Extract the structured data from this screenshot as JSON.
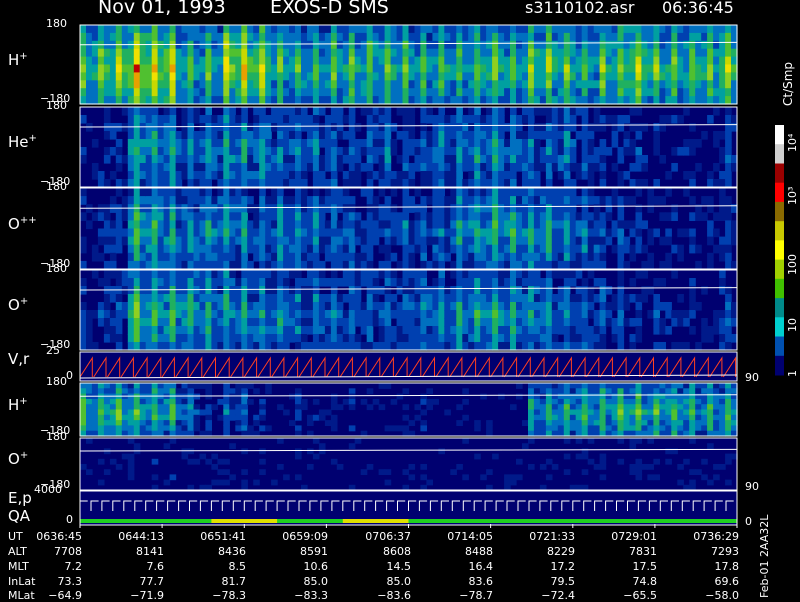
{
  "header": {
    "date": "Nov 01, 1993",
    "instrument": "EXOS-D SMS",
    "file": "s3110102.asr",
    "time": "06:36:45"
  },
  "chart_data": [
    {
      "type": "heatmap",
      "species": "H",
      "charge": "+",
      "y_ticks": [
        "180",
        "−180"
      ],
      "intensity": [
        0.6,
        0.7,
        0.9,
        0.85,
        0.5,
        0.55,
        0.8,
        0.75,
        0.55,
        0.5,
        0.55,
        0.6,
        0.55,
        0.6,
        0.5,
        0.55,
        0.5,
        0.6,
        0.55,
        0.65,
        0.6,
        0.5,
        0.6,
        0.7,
        0.6,
        0.55,
        0.6,
        0.7
      ]
    },
    {
      "type": "heatmap",
      "species": "He",
      "charge": "+",
      "y_ticks": [
        "180",
        "−180"
      ],
      "intensity": [
        0.1,
        0.15,
        0.45,
        0.4,
        0.3,
        0.35,
        0.4,
        0.35,
        0.3,
        0.3,
        0.25,
        0.2,
        0.25,
        0.2,
        0.25,
        0.3,
        0.35,
        0.4,
        0.3,
        0.25,
        0.3,
        0.2,
        0.15,
        0.15,
        0.1,
        0.1,
        0.1,
        0.2
      ]
    },
    {
      "type": "heatmap",
      "species": "O",
      "charge": "++",
      "y_ticks": [
        "180",
        "−180"
      ],
      "intensity": [
        0.1,
        0.2,
        0.5,
        0.45,
        0.35,
        0.4,
        0.35,
        0.3,
        0.35,
        0.3,
        0.25,
        0.25,
        0.2,
        0.25,
        0.25,
        0.3,
        0.4,
        0.45,
        0.45,
        0.4,
        0.35,
        0.3,
        0.2,
        0.15,
        0.1,
        0.1,
        0.1,
        0.2
      ]
    },
    {
      "type": "heatmap",
      "species": "O",
      "charge": "+",
      "y_ticks": [
        "180",
        "−180"
      ],
      "intensity": [
        0.15,
        0.2,
        0.55,
        0.5,
        0.45,
        0.4,
        0.4,
        0.35,
        0.35,
        0.3,
        0.3,
        0.25,
        0.25,
        0.25,
        0.3,
        0.35,
        0.4,
        0.45,
        0.4,
        0.35,
        0.3,
        0.25,
        0.2,
        0.15,
        0.15,
        0.1,
        0.1,
        0.2
      ]
    },
    {
      "type": "line",
      "label": "V,r",
      "y_ticks": [
        "25",
        "0"
      ],
      "right_tick": "90"
    },
    {
      "type": "heatmap",
      "species": "H",
      "charge": "+",
      "y_ticks": [
        "180",
        "−180"
      ],
      "intensity": [
        0.5,
        0.55,
        0.5,
        0.5,
        0.3,
        0.15,
        0.25,
        0.1,
        0.05,
        0.1,
        0.05,
        0.1,
        0.05,
        0.05,
        0.1,
        0.05,
        0.05,
        0.05,
        0.05,
        0.4,
        0.45,
        0.5,
        0.5,
        0.55,
        0.5,
        0.5,
        0.45,
        0.5
      ]
    },
    {
      "type": "heatmap",
      "species": "O",
      "charge": "+",
      "y_ticks": [
        "180",
        "−180"
      ],
      "right_tick": "90",
      "intensity": [
        0.05,
        0.05,
        0.05,
        0.1,
        0.05,
        0.05,
        0.05,
        0.05,
        0.05,
        0.05,
        0.05,
        0.05,
        0.05,
        0.05,
        0.05,
        0.05,
        0.05,
        0.05,
        0.05,
        0.05,
        0.05,
        0.05,
        0.05,
        0.05,
        0.05,
        0.05,
        0.05,
        0.05
      ]
    },
    {
      "type": "line",
      "label": "E,p",
      "label2": "QA",
      "y_ticks": [
        "4000",
        "0"
      ],
      "right_tick": "0"
    }
  ],
  "colorbar": {
    "unit": "Ct/Smp",
    "ticks": [
      "10⁴",
      "10³",
      "100",
      "10",
      "1"
    ],
    "colors": [
      "#ffffff",
      "#d0d0d0",
      "#9a0000",
      "#ff0000",
      "#8a6a00",
      "#c8c800",
      "#ffff00",
      "#a0d000",
      "#40c000",
      "#008a8a",
      "#00d0d0",
      "#0050b0",
      "#000070"
    ]
  },
  "table": {
    "row_labels": [
      "UT",
      "ALT",
      "MLT",
      "InLat",
      "MLat"
    ],
    "columns": [
      [
        "0636:45",
        "7708",
        "7.2",
        "73.3",
        "−64.9"
      ],
      [
        "0644:13",
        "8141",
        "7.6",
        "77.7",
        "−71.9"
      ],
      [
        "0651:41",
        "8436",
        "8.5",
        "81.7",
        "−78.3"
      ],
      [
        "0659:09",
        "8591",
        "10.6",
        "85.0",
        "−83.3"
      ],
      [
        "0706:37",
        "8608",
        "14.5",
        "85.0",
        "−83.6"
      ],
      [
        "0714:05",
        "8488",
        "16.4",
        "83.6",
        "−78.7"
      ],
      [
        "0721:33",
        "8229",
        "17.2",
        "79.5",
        "−72.4"
      ],
      [
        "0729:01",
        "7831",
        "17.5",
        "74.8",
        "−65.5"
      ],
      [
        "0736:29",
        "7293",
        "17.8",
        "69.6",
        "−58.0"
      ]
    ]
  },
  "side_label": "Feb-01 2AA32L"
}
